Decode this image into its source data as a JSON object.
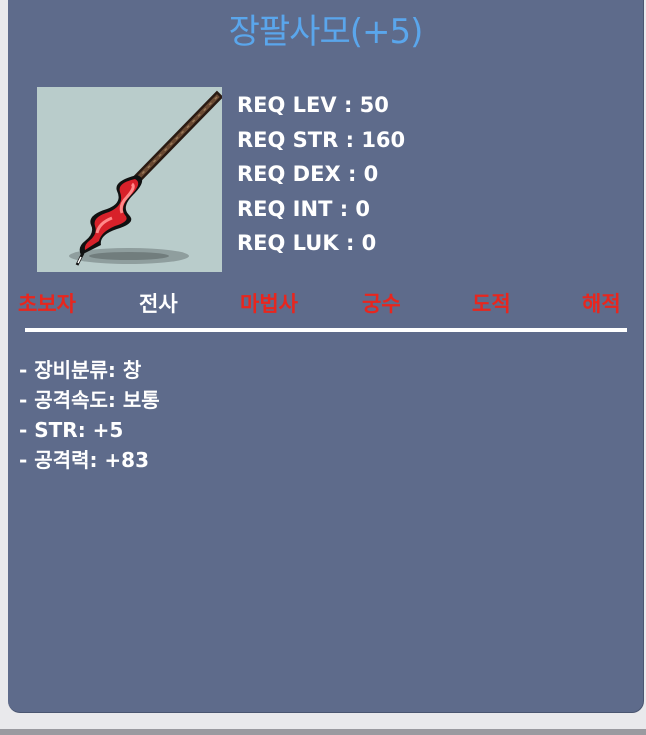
{
  "item": {
    "name": "장팔사모(+5)",
    "image_icon": "spear-item-icon",
    "title_color": "#5aa6ec"
  },
  "requirements": [
    "REQ LEV : 50",
    "REQ STR : 160",
    "REQ DEX : 0",
    "REQ INT : 0",
    "REQ LUK : 0"
  ],
  "jobs": [
    {
      "label": "초보자",
      "color": "#e8261e"
    },
    {
      "label": "전사",
      "color": "#ffffff"
    },
    {
      "label": "마법사",
      "color": "#e8261e"
    },
    {
      "label": "궁수",
      "color": "#e8261e"
    },
    {
      "label": "도적",
      "color": "#e8261e"
    },
    {
      "label": "해적",
      "color": "#e8261e"
    }
  ],
  "stats": [
    "- 장비분류: 창",
    "- 공격속도: 보통",
    "- STR: +5",
    "- 공격력: +83"
  ],
  "colors": {
    "card_background": "#5e6b8b",
    "job_unavailable": "#e8261e",
    "job_available": "#ffffff"
  }
}
